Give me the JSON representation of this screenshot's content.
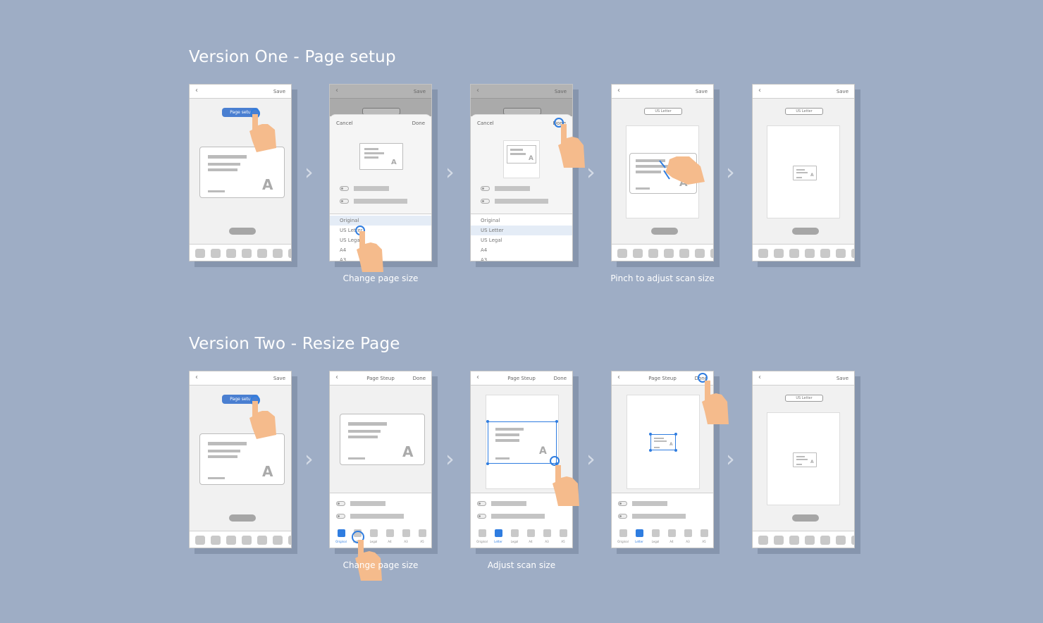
{
  "sections": [
    {
      "title": "Version One - Page setup"
    },
    {
      "title": "Version Two - Resize Page"
    }
  ],
  "common": {
    "back_glyph": "‹",
    "save": "Save",
    "cancel": "Cancel",
    "done": "Done",
    "page_setup_pill": "Page setu",
    "us_letter_badge": "US Letter",
    "page_steup": "Page Steup",
    "chevron_glyph": "›"
  },
  "size_list": [
    "Original",
    "US Letter",
    "US Legal",
    "A4",
    "A3"
  ],
  "size_chips": [
    "Original",
    "Letter",
    "Legal",
    "A4",
    "A3",
    "A5"
  ],
  "captions": {
    "v1_change": "Change page size",
    "v1_pinch": "Pinch to adjust scan size",
    "v2_change": "Change page size",
    "v2_adjust": "Adjust scan size"
  },
  "colors": {
    "background": "#9eadc5",
    "accent": "#2f7de0",
    "hand": "#f5bb8c"
  },
  "icons": [
    "chevron-left-icon",
    "chevron-right-icon",
    "tap-hand-icon",
    "pinch-hand-icon",
    "adobe-logo-icon",
    "toggle-icon"
  ]
}
